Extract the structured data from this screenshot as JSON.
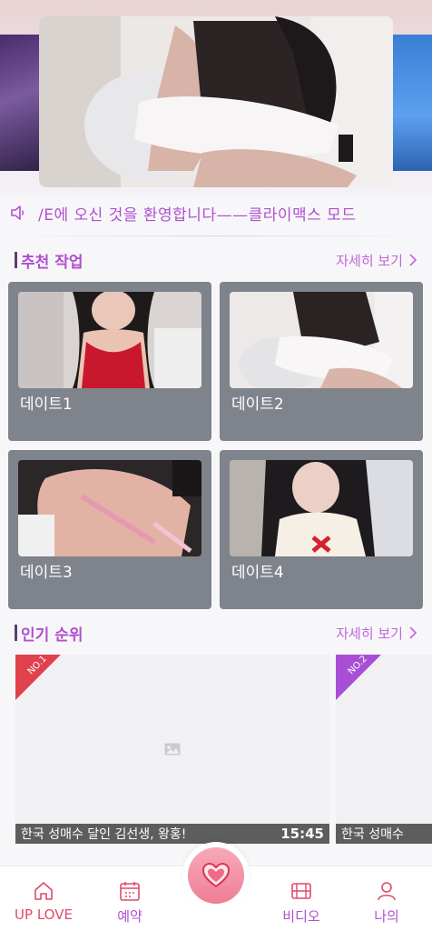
{
  "notice": {
    "text": "/E에 오신 것을 환영합니다——클라이맥스 모드",
    "icon": "speaker-icon"
  },
  "recommended": {
    "title": "추천 작업",
    "more_label": "자세히 보기",
    "cards": [
      {
        "label": "데이트1"
      },
      {
        "label": "데이트2"
      },
      {
        "label": "데이트3"
      },
      {
        "label": "데이트4"
      }
    ]
  },
  "popular": {
    "title": "인기 순위",
    "more_label": "자세히 보기",
    "items": [
      {
        "rank": "NO.1",
        "title": "한국 성매수 달인 김선생, 왕홍!",
        "duration": "15:45",
        "ribbon_color": "#e0424d"
      },
      {
        "rank": "NO.2",
        "title": "한국 성매수",
        "duration": "",
        "ribbon_color": "#a94fd6"
      }
    ]
  },
  "tabbar": {
    "tabs": [
      {
        "label": "UP LOVE",
        "icon": "home-icon",
        "active": true
      },
      {
        "label": "예약",
        "icon": "calendar-icon",
        "active": false
      },
      {
        "label": "비디오",
        "icon": "film-icon",
        "active": false
      },
      {
        "label": "나의",
        "icon": "user-icon",
        "active": false
      }
    ],
    "center_icon": "heart-icon"
  },
  "colors": {
    "accent": "#b14fcf",
    "active": "#e04a69",
    "card_bg": "#7f838c"
  }
}
